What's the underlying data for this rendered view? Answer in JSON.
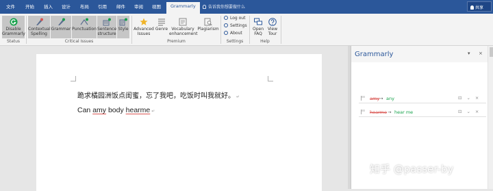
{
  "tabs": [
    {
      "label": "文件"
    },
    {
      "label": "开始"
    },
    {
      "label": "插入"
    },
    {
      "label": "设计"
    },
    {
      "label": "布局"
    },
    {
      "label": "引用"
    },
    {
      "label": "邮件"
    },
    {
      "label": "审阅"
    },
    {
      "label": "视图"
    },
    {
      "label": "Grammarly"
    }
  ],
  "tellme": "告诉我你想要做什么",
  "share": "共享",
  "ribbon": {
    "status_group": {
      "label": "Status",
      "disable_label": "Disable Grammarly"
    },
    "critical_group": {
      "label": "Critical Issues",
      "buttons": [
        {
          "label": "Contextual Spelling"
        },
        {
          "label": "Grammar"
        },
        {
          "label": "Punctuation"
        },
        {
          "label": "Sentence structure"
        },
        {
          "label": "Style"
        }
      ]
    },
    "premium_group": {
      "label": "Premium",
      "buttons": [
        {
          "label": "Advanced Issues"
        },
        {
          "label": "Genre"
        },
        {
          "label": "Vocabulary enhancement"
        },
        {
          "label": "Plagiarism"
        }
      ]
    },
    "settings_group": {
      "label": "Settings",
      "items": [
        {
          "label": "Log out"
        },
        {
          "label": "Settings"
        },
        {
          "label": "About"
        }
      ]
    },
    "help_group": {
      "label": "Help",
      "buttons": [
        {
          "label": "Open FAQ"
        },
        {
          "label": "View Tour"
        }
      ]
    }
  },
  "document": {
    "line1": "跪求橘园洲饭点闺蜜，忘了我吧，吃饭时叫我就好。",
    "line2_parts": [
      "Can ",
      "amy",
      " body ",
      "hearme"
    ]
  },
  "pane": {
    "title": "Grammarly",
    "cards": [
      {
        "original": "amy",
        "arrow": "→",
        "suggestion": "any"
      },
      {
        "original": "hearme",
        "arrow": "→",
        "suggestion": "hear me"
      }
    ]
  },
  "watermark": "知乎 @passer-by",
  "colors": {
    "brand": "#2b579a",
    "error": "#d9534f",
    "suggestion": "#15a14a"
  }
}
